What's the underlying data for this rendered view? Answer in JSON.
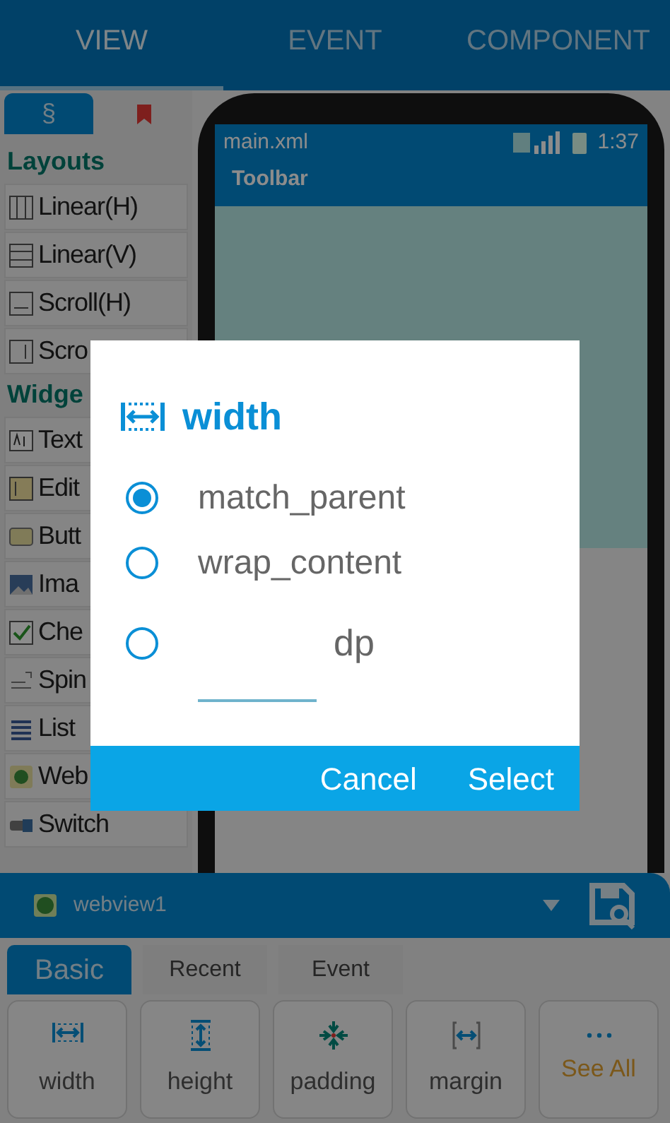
{
  "top_tabs": [
    {
      "label": "VIEW",
      "selected": true
    },
    {
      "label": "EVENT",
      "selected": false
    },
    {
      "label": "COMPONENT",
      "selected": false
    }
  ],
  "palette": {
    "tabs": [
      {
        "kind": "text",
        "label": "§",
        "selected": true
      },
      {
        "kind": "bookmark",
        "selected": false
      }
    ],
    "groups": [
      {
        "title": "Layouts",
        "items": [
          {
            "kind": "columns",
            "label": "Linear(H)"
          },
          {
            "kind": "rows",
            "label": "Linear(V)"
          },
          {
            "kind": "hscroll",
            "label": "Scroll(H)"
          },
          {
            "kind": "vscroll",
            "label": "Scro"
          }
        ]
      },
      {
        "title": "Widge",
        "items": [
          {
            "kind": "text",
            "label": "Text"
          },
          {
            "kind": "edit",
            "label": "Edit"
          },
          {
            "kind": "button",
            "label": "Butt"
          },
          {
            "kind": "image",
            "label": "Ima"
          },
          {
            "kind": "check",
            "label": "Che"
          },
          {
            "kind": "spinner",
            "label": "Spin"
          },
          {
            "kind": "list",
            "label": "List"
          },
          {
            "kind": "web",
            "label": "Web"
          },
          {
            "kind": "switch",
            "label": "Switch"
          }
        ]
      }
    ]
  },
  "phone": {
    "title": "main.xml",
    "time": "1:37",
    "toolbar": "Toolbar"
  },
  "properties": {
    "widget": "webview1",
    "tabs": [
      {
        "label": "Basic",
        "selected": true
      },
      {
        "label": "Recent",
        "selected": false
      },
      {
        "label": "Event",
        "selected": false
      }
    ],
    "buttons": [
      {
        "kind": "width",
        "label": "width"
      },
      {
        "kind": "height",
        "label": "height"
      },
      {
        "kind": "padding",
        "label": "padding"
      },
      {
        "kind": "margin",
        "label": "margin"
      },
      {
        "kind": "more",
        "label": "See All"
      }
    ]
  },
  "dialog": {
    "title": "width",
    "options": [
      {
        "kind": "text",
        "label": "match_parent",
        "selected": true
      },
      {
        "kind": "text",
        "label": "wrap_content",
        "selected": false
      },
      {
        "kind": "custom",
        "unit": "dp",
        "selected": false
      }
    ],
    "buttons": [
      "Cancel",
      "Select"
    ]
  }
}
